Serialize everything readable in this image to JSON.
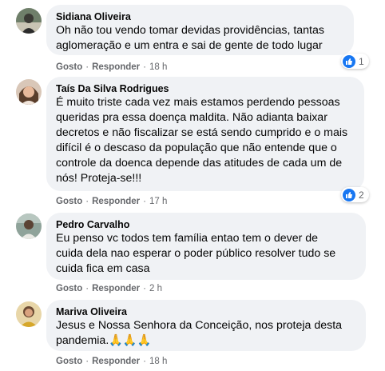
{
  "colors": {
    "bubble_bg": "#f0f2f5",
    "like_blue": "#1877f2",
    "meta_gray": "#65676b"
  },
  "actions": {
    "like_label": "Gosto",
    "reply_label": "Responder",
    "separator": "·"
  },
  "comments": [
    {
      "author": "Sidiana Oliveira",
      "text": "Oh não tou vendo tomar devidas providências, tantas\naglomeração e um entra e sai de gente de todo lugar",
      "time": "18 h",
      "reactions": {
        "icon": "like-icon",
        "count": "1"
      }
    },
    {
      "author": "Taís Da Silva Rodrigues",
      "text": "É muito triste cada vez mais estamos perdendo pessoas\nqueridas pra essa doença maldita. Não adianta baixar\ndecretos e não fiscalizar se está sendo cumprido e o mais\ndifícil é o descaso da população que não entende que o\ncontrole da doenca depende das atitudes de cada um de\nnós! Proteja-se!!!",
      "time": "17 h",
      "reactions": {
        "icon": "like-icon",
        "count": "2"
      }
    },
    {
      "author": "Pedro Carvalho",
      "text": "Eu penso vc todos tem família entao tem o dever de\ncuida dela nao esperar o poder público resolver tudo se\ncuida fica em casa",
      "time": "2 h"
    },
    {
      "author": "Mariva Oliveira",
      "text": "Jesus e Nossa Senhora da Conceição, nos proteja desta\npandemia.🙏🙏🙏",
      "time": "18 h"
    }
  ]
}
